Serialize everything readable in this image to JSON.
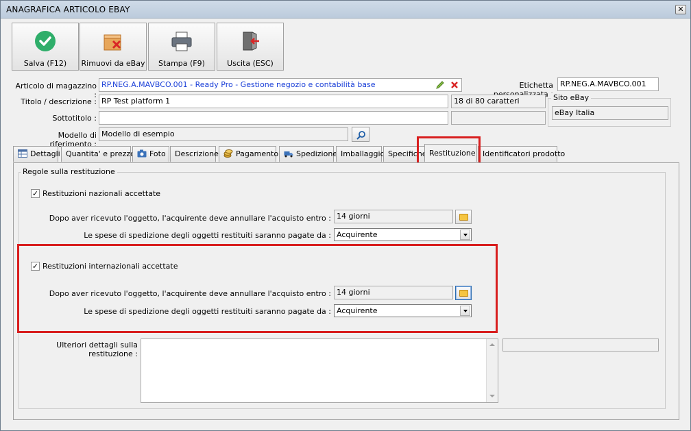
{
  "window": {
    "title": "ANAGRAFICA ARTICOLO EBAY",
    "close": "✕"
  },
  "toolbar": {
    "save": "Salva (F12)",
    "remove": "Rimuovi da eBay",
    "print": "Stampa (F9)",
    "exit": "Uscita (ESC)"
  },
  "form": {
    "article_label": "Articolo di magazzino :",
    "article_value": "RP.NEG.A.MAVBCO.001 - Ready Pro - Gestione negozio e contabilità base",
    "custom_label_label": "Etichetta personalizzata :",
    "custom_label_value": "RP.NEG.A.MAVBCO.001",
    "title_label": "Titolo / descrizione :",
    "title_value": "RP Test platform 1",
    "title_counter": "18 di 80 caratteri",
    "subtitle_label": "Sottotitolo :",
    "subtitle_value": "",
    "model_label": "Modello di riferimento :",
    "model_value": "Modello di esempio",
    "site_legend": "Sito eBay",
    "site_value": "eBay Italia"
  },
  "tabs": [
    {
      "label": "Dettagli",
      "icon": "table-icon"
    },
    {
      "label": "Quantita' e prezzo"
    },
    {
      "label": "Foto",
      "icon": "camera-icon"
    },
    {
      "label": "Descrizione"
    },
    {
      "label": "Pagamento",
      "icon": "coins-icon"
    },
    {
      "label": "Spedizione",
      "icon": "truck-icon"
    },
    {
      "label": "Imballaggio"
    },
    {
      "label": "Specifiche"
    },
    {
      "label": "Restituzione"
    },
    {
      "label": "Identificatori prodotto"
    }
  ],
  "returns": {
    "group_legend": "Regole sulla restituzione",
    "domestic": {
      "checkbox_label": "Restituzioni nazionali accettate",
      "checked": true,
      "period_label": "Dopo aver ricevuto l'oggetto, l'acquirente deve annullare l'acquisto entro :",
      "period_value": "14 giorni",
      "shipping_label": "Le spese di spedizione degli oggetti restituiti saranno pagate da :",
      "shipping_value": "Acquirente"
    },
    "international": {
      "checkbox_label": "Restituzioni internazionali accettate",
      "checked": true,
      "period_label": "Dopo aver ricevuto l'oggetto, l'acquirente deve annullare l'acquisto entro :",
      "period_value": "14 giorni",
      "shipping_label": "Le spese di spedizione degli oggetti restituiti saranno pagate da :",
      "shipping_value": "Acquirente"
    },
    "details_label": "Ulteriori dettagli sulla restituzione :",
    "details_value": ""
  },
  "colors": {
    "highlight": "#d81e1e",
    "link_blue": "#1a3fd8"
  }
}
